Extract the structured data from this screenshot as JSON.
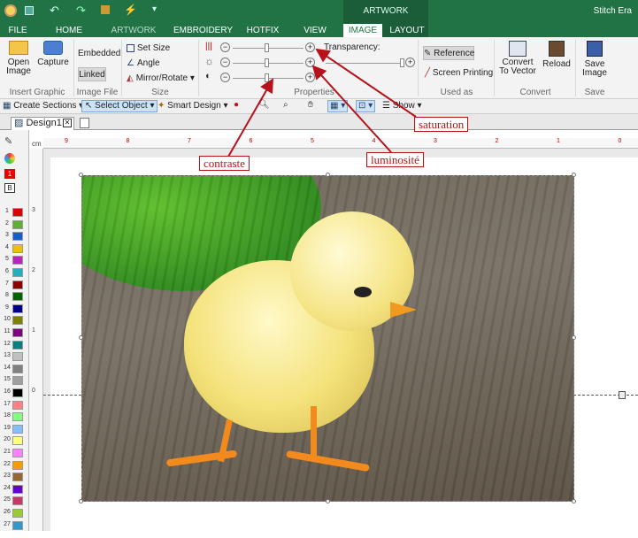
{
  "app": {
    "title": "Stitch Era"
  },
  "context_tab_group": "ARTWORK",
  "tabs": [
    "FILE",
    "HOME",
    "ARTWORK",
    "EMBROIDERY",
    "HOTFIX",
    "VIEW",
    "IMAGE",
    "LAYOUT"
  ],
  "ribbon": {
    "insert_graphic": {
      "open": "Open Image",
      "capture": "Capture",
      "label": "Insert Graphic"
    },
    "image_file": {
      "embedded": "Embedded",
      "linked": "Linked",
      "label": "Image File"
    },
    "size": {
      "set_size": "Set Size",
      "angle": "Angle",
      "mirror": "Mirror/Rotate",
      "label": "Size"
    },
    "properties": {
      "transparency": "Transparency:",
      "label": "Properties"
    },
    "used_as": {
      "reference": "Reference",
      "screen_printing": "Screen Printing",
      "label": "Used as"
    },
    "convert": {
      "convert_vector": "Convert To Vector",
      "reload": "Reload",
      "label": "Convert"
    },
    "save": {
      "save_image": "Save Image",
      "label": "Save"
    }
  },
  "toolbar": {
    "create_sections": "Create Sections",
    "select_object": "Select Object",
    "smart_design": "Smart Design",
    "show": "Show"
  },
  "doc_tab": {
    "name": "Design1"
  },
  "ruler": {
    "unit": "cm",
    "h_ticks": [
      "9",
      "8",
      "7",
      "6",
      "5",
      "4",
      "3",
      "2",
      "1",
      "0"
    ],
    "v_ticks": [
      "3",
      "2",
      "1",
      "0"
    ]
  },
  "palette": [
    {
      "n": "1",
      "c": "#e00000"
    },
    {
      "n": "2",
      "c": "#60b030"
    },
    {
      "n": "3",
      "c": "#1060d0"
    },
    {
      "n": "4",
      "c": "#f0c000"
    },
    {
      "n": "5",
      "c": "#c020c0"
    },
    {
      "n": "6",
      "c": "#20b0c0"
    },
    {
      "n": "7",
      "c": "#8b0000"
    },
    {
      "n": "8",
      "c": "#006400"
    },
    {
      "n": "9",
      "c": "#00008b"
    },
    {
      "n": "10",
      "c": "#808000"
    },
    {
      "n": "11",
      "c": "#800080"
    },
    {
      "n": "12",
      "c": "#008080"
    },
    {
      "n": "13",
      "c": "#c0c0c0"
    },
    {
      "n": "14",
      "c": "#808080"
    },
    {
      "n": "15",
      "c": "#a0a0a0"
    },
    {
      "n": "16",
      "c": "#000000"
    },
    {
      "n": "17",
      "c": "#ff8080"
    },
    {
      "n": "18",
      "c": "#80ff80"
    },
    {
      "n": "19",
      "c": "#80c0ff"
    },
    {
      "n": "20",
      "c": "#ffff80"
    },
    {
      "n": "21",
      "c": "#ff80ff"
    },
    {
      "n": "22",
      "c": "#ff9900"
    },
    {
      "n": "23",
      "c": "#996633"
    },
    {
      "n": "24",
      "c": "#6600cc"
    },
    {
      "n": "25",
      "c": "#cc3366"
    },
    {
      "n": "26",
      "c": "#99cc33"
    },
    {
      "n": "27",
      "c": "#3399cc"
    }
  ],
  "callouts": {
    "saturation": "saturation",
    "contrast": "contraste",
    "luminosity": "luminosité"
  },
  "colors": {
    "accent": "#217346",
    "callout": "#b7121b"
  }
}
